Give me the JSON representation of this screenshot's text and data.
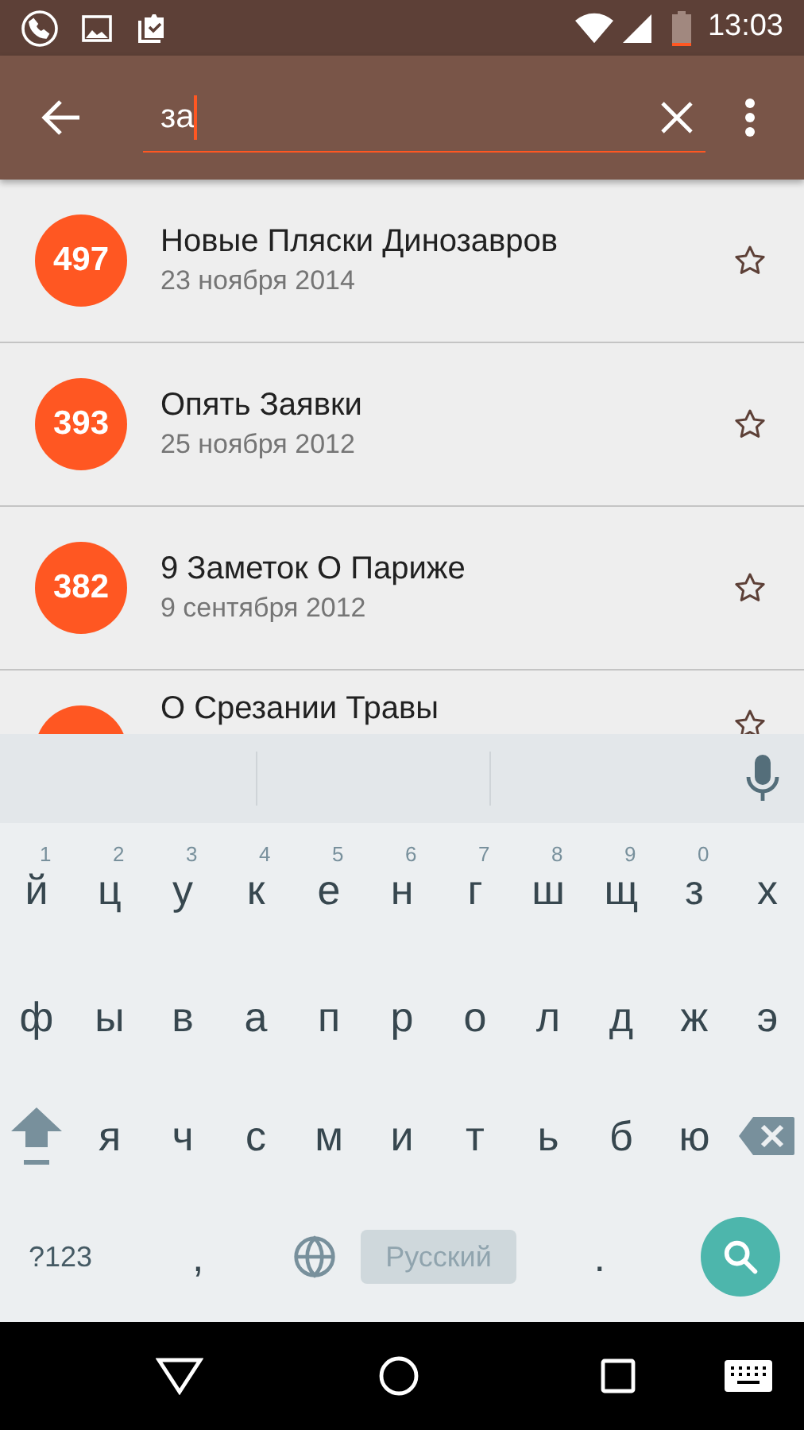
{
  "status_bar": {
    "time": "13:03"
  },
  "search": {
    "value": "за"
  },
  "results": [
    {
      "number": "497",
      "title": "Новые Пляски Динозавров",
      "date": "23 ноября 2014",
      "starred": false
    },
    {
      "number": "393",
      "title": "Опять Заявки",
      "date": "25 ноября 2012",
      "starred": false
    },
    {
      "number": "382",
      "title": "9 Заметок О Париже",
      "date": "9 сентября 2012",
      "starred": false
    },
    {
      "title": "О Срезании Травы",
      "starred": false
    }
  ],
  "keyboard": {
    "rows": [
      [
        {
          "kind": "char",
          "label": "й",
          "hint": "1"
        },
        {
          "kind": "char",
          "label": "ц",
          "hint": "2"
        },
        {
          "kind": "char",
          "label": "у",
          "hint": "3"
        },
        {
          "kind": "char",
          "label": "к",
          "hint": "4"
        },
        {
          "kind": "char",
          "label": "е",
          "hint": "5"
        },
        {
          "kind": "char",
          "label": "н",
          "hint": "6"
        },
        {
          "kind": "char",
          "label": "г",
          "hint": "7"
        },
        {
          "kind": "char",
          "label": "ш",
          "hint": "8"
        },
        {
          "kind": "char",
          "label": "щ",
          "hint": "9"
        },
        {
          "kind": "char",
          "label": "з",
          "hint": "0"
        },
        {
          "kind": "char",
          "label": "х"
        }
      ],
      [
        {
          "kind": "char",
          "label": "ф"
        },
        {
          "kind": "char",
          "label": "ы"
        },
        {
          "kind": "char",
          "label": "в"
        },
        {
          "kind": "char",
          "label": "а"
        },
        {
          "kind": "char",
          "label": "п"
        },
        {
          "kind": "char",
          "label": "р"
        },
        {
          "kind": "char",
          "label": "о"
        },
        {
          "kind": "char",
          "label": "л"
        },
        {
          "kind": "char",
          "label": "д"
        },
        {
          "kind": "char",
          "label": "ж"
        },
        {
          "kind": "char",
          "label": "э"
        }
      ],
      [
        {
          "kind": "shift"
        },
        {
          "kind": "char",
          "label": "я"
        },
        {
          "kind": "char",
          "label": "ч"
        },
        {
          "kind": "char",
          "label": "с"
        },
        {
          "kind": "char",
          "label": "м"
        },
        {
          "kind": "char",
          "label": "и"
        },
        {
          "kind": "char",
          "label": "т"
        },
        {
          "kind": "char",
          "label": "ь"
        },
        {
          "kind": "char",
          "label": "б"
        },
        {
          "kind": "char",
          "label": "ю"
        },
        {
          "kind": "backspace"
        }
      ]
    ],
    "bottom_row": {
      "symbols_key": "?123",
      "comma_key": ",",
      "space_key": "Русский",
      "period_key": "."
    }
  }
}
